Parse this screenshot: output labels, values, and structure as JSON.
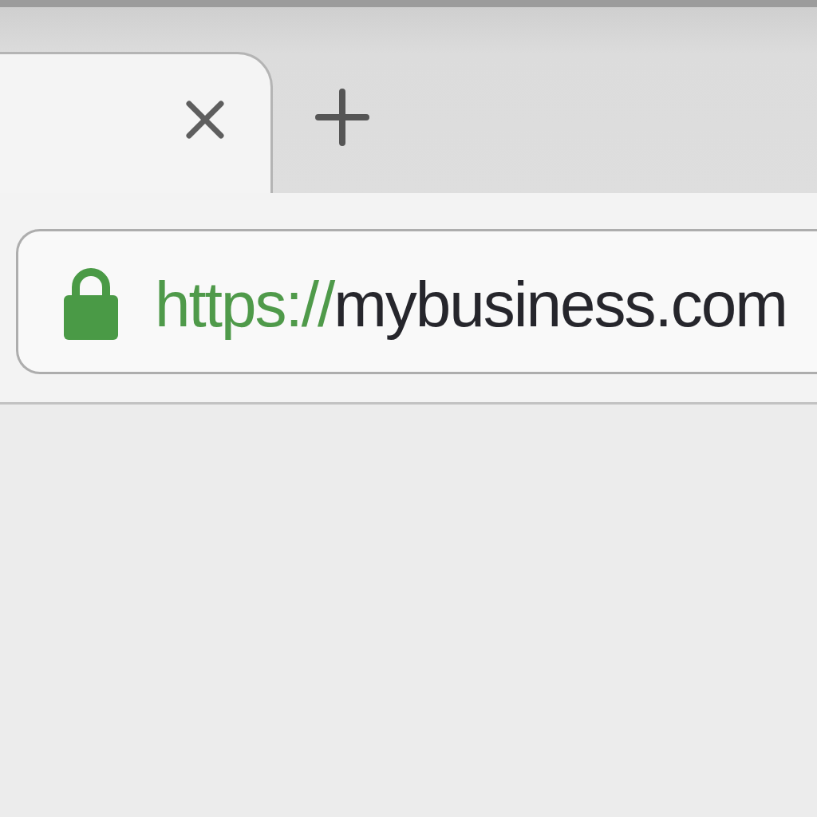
{
  "tabs": [
    {
      "selected": true
    }
  ],
  "address_bar": {
    "secure": true,
    "scheme": "https://",
    "host": "mybusiness.com"
  }
}
